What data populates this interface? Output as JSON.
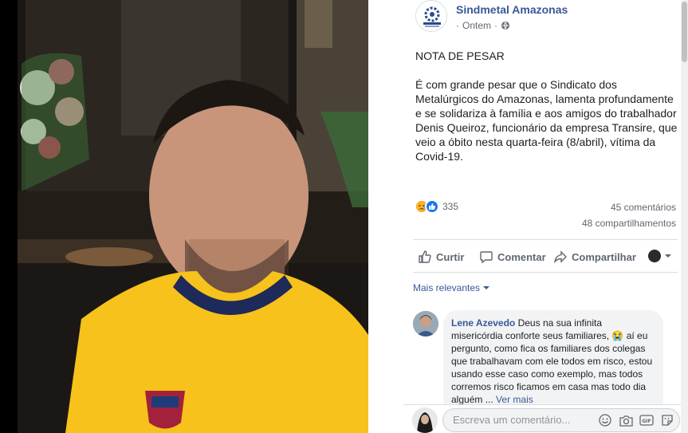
{
  "post": {
    "page_name": "Sindmetal Amazonas",
    "timestamp": "Ontem",
    "privacy_icon": "globe-icon",
    "title_line": "NOTA DE PESAR",
    "body": "É com grande pesar que o Sindicato dos Metalúrgicos do Amazonas, lamenta profundamente e se solidariza à família e aos amigos do trabalhador Denis Queiroz, funcionário da empresa Transire, que veio a óbito nesta quarta-feira (8/abril), vítima da Covid-19."
  },
  "stats": {
    "reaction_count": "335",
    "comments": "45 comentários",
    "shares": "48 compartilhamentos",
    "reaction_icons": [
      "sad-reaction-icon",
      "like-reaction-icon"
    ]
  },
  "actions": {
    "like": "Curtir",
    "comment": "Comentar",
    "share": "Compartilhar"
  },
  "sort": {
    "label": "Mais relevantes"
  },
  "comments": [
    {
      "author": "Lene Azevedo",
      "text_part1": "Deus na sua infinita misericórdia conforte seus familiares,",
      "text_part2": "aí eu pergunto, como fica os familiares dos colegas que trabalhavam com ele todos em risco, estou usando esse caso como exemplo, mas todos corremos risco ficamos em casa mas todo dia alguém ...",
      "see_more": "Ver mais"
    }
  ],
  "composer": {
    "placeholder": "Escreva um comentário..."
  },
  "colors": {
    "link_blue": "#385898",
    "photo_bg": "#000000",
    "jersey_yellow": "#f6c21b"
  }
}
